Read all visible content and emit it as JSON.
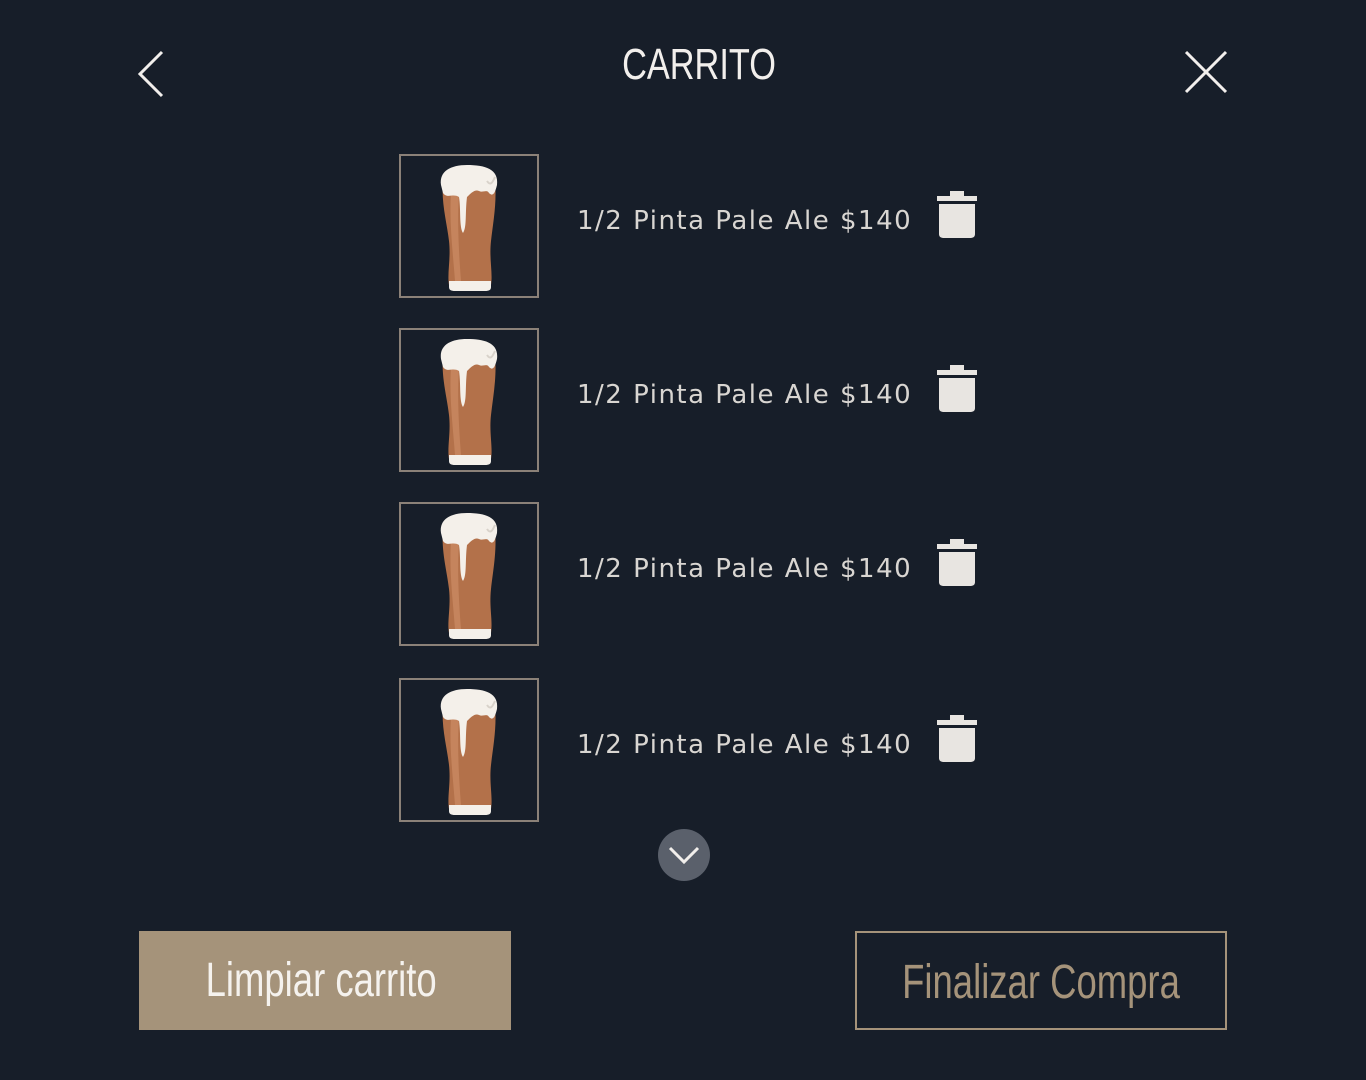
{
  "header": {
    "title": "CARRITO",
    "back_icon": "chevron-left-icon",
    "close_icon": "close-icon"
  },
  "cart": {
    "items": [
      {
        "label": "1/2 Pinta Pale Ale $140",
        "image": "beer-glass-icon",
        "remove_icon": "trash-icon"
      },
      {
        "label": "1/2 Pinta Pale Ale $140",
        "image": "beer-glass-icon",
        "remove_icon": "trash-icon"
      },
      {
        "label": "1/2 Pinta Pale Ale $140",
        "image": "beer-glass-icon",
        "remove_icon": "trash-icon"
      },
      {
        "label": "1/2 Pinta Pale Ale $140",
        "image": "beer-glass-icon",
        "remove_icon": "trash-icon"
      }
    ],
    "scroll_icon": "chevron-down-icon"
  },
  "actions": {
    "clear_label": "Limpiar carrito",
    "finish_label": "Finalizar Compra"
  },
  "colors": {
    "background": "#171e29",
    "accent": "#a5937a",
    "text": "#e9e6e2",
    "beer": "#b3714a",
    "foam": "#f4f0ea"
  }
}
